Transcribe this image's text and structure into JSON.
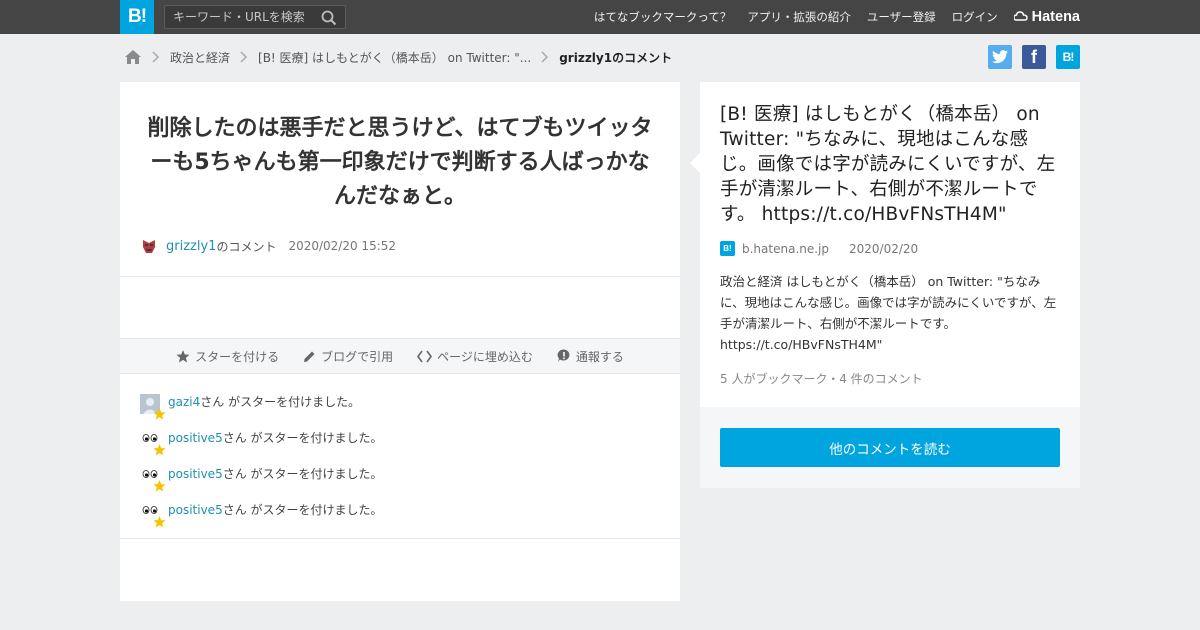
{
  "topbar": {
    "logo": "B!",
    "search_placeholder": "キーワード・URLを検索",
    "nav": [
      "はてなブックマークって？",
      "アプリ・拡張の紹介",
      "ユーザー登録",
      "ログイン"
    ],
    "brand": "Hatena"
  },
  "breadcrumb": {
    "items": [
      "政治と経済",
      "[B! 医療] はしもとがく（橋本岳） on Twitter: \"...",
      "grizzly1のコメント"
    ]
  },
  "share": {
    "twitter": "twitter-icon",
    "facebook": "f",
    "hatena": "B!"
  },
  "comment": {
    "text": "削除したのは悪手だと思うけど、はてブもツイッターも5ちゃんも第一印象だけで判断する人ばっかなんだなぁと。",
    "user": "grizzly1",
    "suffix": "のコメント",
    "date": "2020/02/20 15:52"
  },
  "actions": [
    "スターを付ける",
    "ブログで引用",
    "ページに埋め込む",
    "通報する"
  ],
  "stars": [
    {
      "user": "gazi4",
      "text": "さん がスターを付けました。"
    },
    {
      "user": "positive5",
      "text": "さん がスターを付けました。"
    },
    {
      "user": "positive5",
      "text": "さん がスターを付けました。"
    },
    {
      "user": "positive5",
      "text": "さん がスターを付けました。"
    }
  ],
  "entry": {
    "title": "[B! 医療] はしもとがく（橋本岳） on Twitter: \"ちなみに、現地はこんな感じ。画像では字が読みにくいですが、左手が清潔ルート、右側が不潔ルートです。 https://t.co/HBvFNsTH4M\"",
    "source": "b.hatena.ne.jp",
    "date": "2020/02/20",
    "description": "政治と経済 はしもとがく（橋本岳） on Twitter: \"ちなみに、現地はこんな感じ。画像では字が読みにくいですが、左手が清潔ルート、右側が不潔ルートです。 https://t.co/HBvFNsTH4M\"",
    "counts": "5 人がブックマーク・4 件のコメント",
    "read_more": "他のコメントを読む"
  },
  "colors": {
    "accent": "#00a4de",
    "topbar": "#454545",
    "link": "#1f8fb3",
    "star": "#f5c400"
  }
}
